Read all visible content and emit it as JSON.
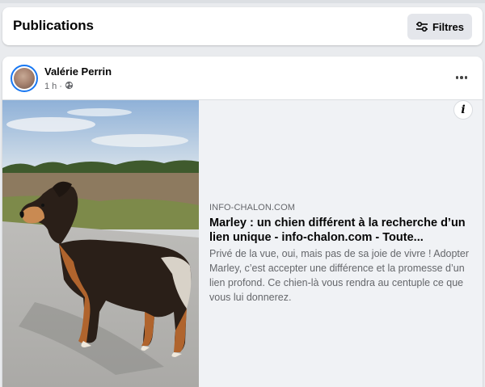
{
  "header": {
    "title": "Publications",
    "filters_label": "Filtres",
    "filters_icon": "sliders-icon"
  },
  "post": {
    "author": "Valérie Perrin",
    "time": "1 h",
    "separator": "·",
    "audience_icon": "globe-icon",
    "more_icon": "more-horizontal-icon",
    "link": {
      "domain": "INFO-CHALON.COM",
      "title": "Marley : un chien différent à la recherche d’un lien unique - info-chalon.com - Toute...",
      "description": "Privé de la vue, oui, mais pas de sa joie de vivre ! Adopter Marley, c’est accepter une différence et la promesse d’un lien profond. Ce chien-là vous rendra au centuple ce que vous lui donnerez.",
      "info_icon": "info-icon",
      "image": "photo of a brown and black dog on a dirt path near a field"
    }
  },
  "colors": {
    "page_bg": "#e9ebee",
    "accent": "#1877f2",
    "secondary_text": "#65676b",
    "button_bg": "#e4e6eb",
    "link_body_bg": "#f0f2f5"
  }
}
